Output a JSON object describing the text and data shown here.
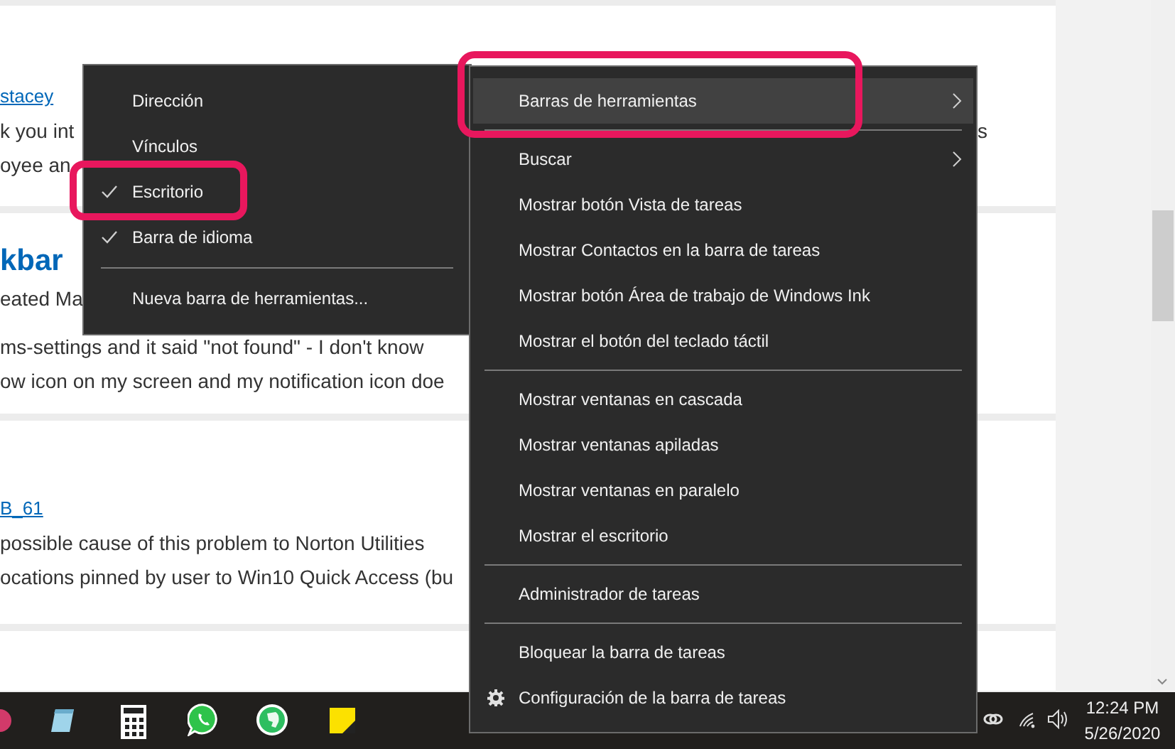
{
  "page": {
    "posts": [
      {
        "kind": "reply",
        "lines": [
          {
            "kind": "link",
            "text": "stacey"
          },
          {
            "kind": "body",
            "text": "k you int",
            "right": "s"
          },
          {
            "kind": "body",
            "text": "oyee an"
          }
        ]
      },
      {
        "kind": "question",
        "lines": [
          {
            "kind": "title",
            "text": "kbar"
          },
          {
            "kind": "meta",
            "text": "eated Ma"
          },
          {
            "kind": "body",
            "text": "ms-settings and it said \"not found\" - I don't know"
          },
          {
            "kind": "body",
            "text": "ow icon on my screen and my notification icon doe"
          }
        ]
      },
      {
        "kind": "reply",
        "lines": [
          {
            "kind": "link",
            "text": "B_61"
          },
          {
            "kind": "body",
            "text": "possible cause of this problem to Norton Utilities"
          },
          {
            "kind": "body",
            "text": "ocations pinned by user to Win10 Quick Access (bu"
          }
        ]
      },
      {
        "kind": "empty"
      }
    ]
  },
  "toolbars_submenu": {
    "items": [
      {
        "kind": "item",
        "label": "Dirección",
        "checked": false
      },
      {
        "kind": "item",
        "label": "Vínculos",
        "checked": false
      },
      {
        "kind": "item",
        "label": "Escritorio",
        "checked": true
      },
      {
        "kind": "item",
        "label": "Barra de idioma",
        "checked": true
      },
      {
        "kind": "separator"
      },
      {
        "kind": "item",
        "label": "Nueva barra de herramientas...",
        "checked": false
      }
    ]
  },
  "context_menu": {
    "items": [
      {
        "kind": "item",
        "label": "Barras de herramientas",
        "selected": true,
        "has_submenu": true
      },
      {
        "kind": "separator"
      },
      {
        "kind": "item",
        "label": "Buscar",
        "selected": false,
        "has_submenu": true
      },
      {
        "kind": "item",
        "label": "Mostrar botón Vista de tareas",
        "selected": false,
        "has_submenu": false
      },
      {
        "kind": "item",
        "label": "Mostrar Contactos en la barra de tareas",
        "selected": false,
        "has_submenu": false
      },
      {
        "kind": "item",
        "label": "Mostrar botón Área de trabajo de Windows Ink",
        "selected": false,
        "has_submenu": false
      },
      {
        "kind": "item",
        "label": "Mostrar el botón del teclado táctil",
        "selected": false,
        "has_submenu": false
      },
      {
        "kind": "separator"
      },
      {
        "kind": "item",
        "label": "Mostrar ventanas en cascada",
        "selected": false,
        "has_submenu": false
      },
      {
        "kind": "item",
        "label": "Mostrar ventanas apiladas",
        "selected": false,
        "has_submenu": false
      },
      {
        "kind": "item",
        "label": "Mostrar ventanas en paralelo",
        "selected": false,
        "has_submenu": false
      },
      {
        "kind": "item",
        "label": "Mostrar el escritorio",
        "selected": false,
        "has_submenu": false
      },
      {
        "kind": "separator"
      },
      {
        "kind": "item",
        "label": "Administrador de tareas",
        "selected": false,
        "has_submenu": false
      },
      {
        "kind": "separator"
      },
      {
        "kind": "item",
        "label": "Bloquear la barra de tareas",
        "selected": false,
        "has_submenu": false
      },
      {
        "kind": "icon_item",
        "label": "Configuración de la barra de tareas",
        "selected": false,
        "has_submenu": false
      }
    ]
  },
  "taskbar": {
    "clock": {
      "time": "12:24 PM",
      "date": "5/26/2020"
    }
  }
}
